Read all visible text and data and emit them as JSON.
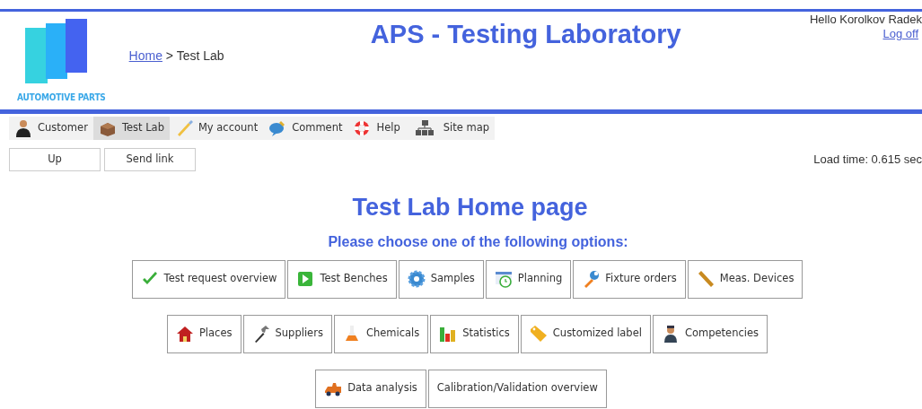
{
  "header": {
    "logo_text": "AUTOMOTIVE PARTS",
    "breadcrumb": {
      "home": "Home",
      "separator": ">",
      "current": "Test Lab"
    },
    "title": "APS - Testing Laboratory",
    "greeting": "Hello Korolkov Radek",
    "logoff": "Log off"
  },
  "menu": [
    {
      "label": "Customer",
      "selected": false
    },
    {
      "label": "Test Lab",
      "selected": true
    },
    {
      "label": "My account",
      "selected": false
    },
    {
      "label": "Comment",
      "selected": false
    },
    {
      "label": "Help",
      "selected": false
    },
    {
      "label": "Site map",
      "selected": false
    }
  ],
  "actions": [
    "Up",
    "Send link"
  ],
  "load_time": "Load time: 0.615 sec",
  "page_title": "Test Lab Home page",
  "prompt": "Please choose one of the following options:",
  "option_rows": [
    [
      "Test request overview",
      "Test Benches",
      "Samples",
      "Planning",
      "Fixture orders",
      "Meas. Devices"
    ],
    [
      "Places",
      "Suppliers",
      "Chemicals",
      "Statistics",
      "Customized label",
      "Competencies"
    ],
    [
      "Data analysis",
      "Calibration/Validation overview"
    ]
  ]
}
